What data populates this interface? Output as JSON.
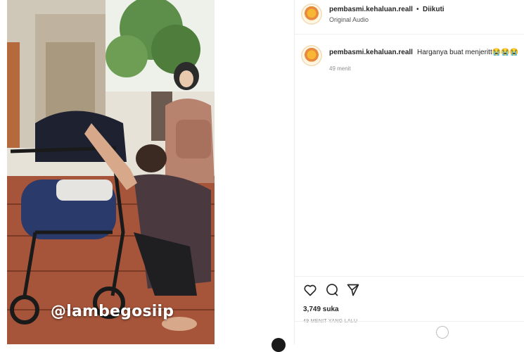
{
  "post": {
    "username": "pembasmi.kehaluan.reall",
    "separator": "•",
    "follow_status": "Diikuti",
    "audio": "Original Audio",
    "caption": {
      "username": "pembasmi.kehaluan.reall",
      "text": "Harganya buat menjeritt😭😭😭",
      "time": "49 menit"
    },
    "likes": "3,749 suka",
    "posted_ago": "49 MENIT YANG LALU",
    "comment_placeholder": ""
  },
  "media": {
    "watermark": "@lambegosiip"
  },
  "icons": {
    "like": "heart-icon",
    "comment": "comment-icon",
    "share": "send-icon",
    "emoji": "emoji-icon"
  },
  "colors": {
    "text": "#262626",
    "muted": "#8e8e8e",
    "border": "#efefef"
  }
}
